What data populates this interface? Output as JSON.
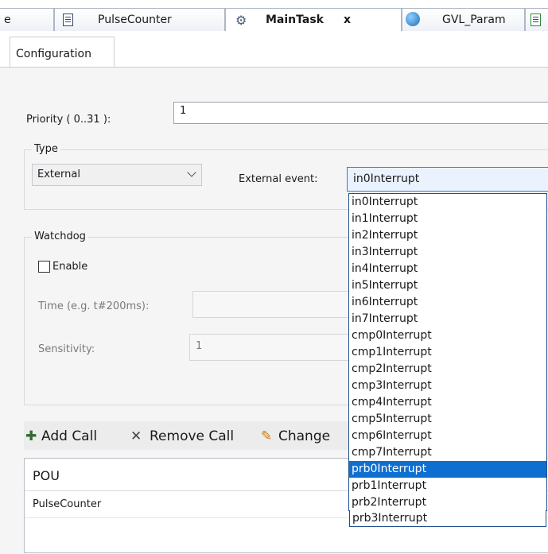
{
  "tabs": [
    {
      "label": "e"
    },
    {
      "label": "PulseCounter"
    },
    {
      "label": "MainTask",
      "close": "x"
    },
    {
      "label": "GVL_Param"
    }
  ],
  "subtab": {
    "label": "Configuration"
  },
  "priority": {
    "label": "Priority ( 0..31 ):",
    "value": "1"
  },
  "type_group": {
    "legend": "Type",
    "select_value": "External",
    "event_label": "External event:",
    "event_value": "in0Interrupt"
  },
  "watchdog": {
    "legend": "Watchdog",
    "enable_label": "Enable",
    "time_label": "Time (e.g. t#200ms):",
    "sensitivity_label": "Sensitivity:",
    "sensitivity_value": "1"
  },
  "toolbar": {
    "add_call": "Add Call",
    "remove_call": "Remove Call",
    "change": "Change"
  },
  "grid": {
    "header": "POU",
    "row1": "PulseCounter"
  },
  "dropdown": {
    "items": [
      "in0Interrupt",
      "in1Interrupt",
      "in2Interrupt",
      "in3Interrupt",
      "in4Interrupt",
      "in5Interrupt",
      "in6Interrupt",
      "in7Interrupt",
      "cmp0Interrupt",
      "cmp1Interrupt",
      "cmp2Interrupt",
      "cmp3Interrupt",
      "cmp4Interrupt",
      "cmp5Interrupt",
      "cmp6Interrupt",
      "cmp7Interrupt",
      "prb0Interrupt",
      "prb1Interrupt",
      "prb2Interrupt",
      "prb3Interrupt"
    ],
    "selected": "prb0Interrupt"
  },
  "colors": {
    "selection": "#0f6fd1",
    "dropdown_border": "#1e4f8d"
  }
}
